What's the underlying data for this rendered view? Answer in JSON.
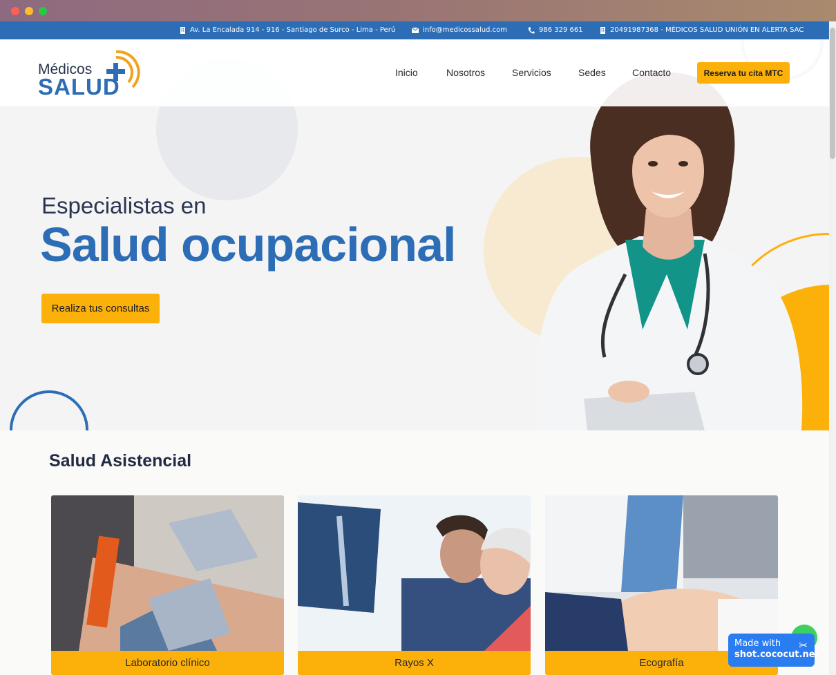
{
  "topbar": {
    "address": "Av. La Encalada 914 - 916 - Santiago de Surco - Lima - Perú",
    "email": "info@medicossalud.com",
    "phone": "986 329 661",
    "ruc": "20491987368 - MÉDICOS SALUD UNIÓN EN ALERTA SAC"
  },
  "logo": {
    "line1": "Médicos",
    "line2": "SALUD"
  },
  "nav": {
    "items": [
      "Inicio",
      "Nosotros",
      "Servicios",
      "Sedes",
      "Contacto"
    ],
    "cta": "Reserva tu cita MTC"
  },
  "hero": {
    "subtitle": "Especialistas en",
    "title": "Salud ocupacional",
    "cta": "Realiza tus consultas"
  },
  "section": {
    "title": "Salud Asistencial",
    "cards": [
      {
        "label": "Laboratorio clínico"
      },
      {
        "label": "Rayos X"
      },
      {
        "label": "Ecografía"
      }
    ]
  },
  "badge": {
    "line1": "Made with",
    "line2": "shot.cococut.net"
  },
  "colors": {
    "brand_blue": "#2d6db5",
    "accent_orange": "#fcb00a",
    "whatsapp_green": "#3fcf5e"
  }
}
